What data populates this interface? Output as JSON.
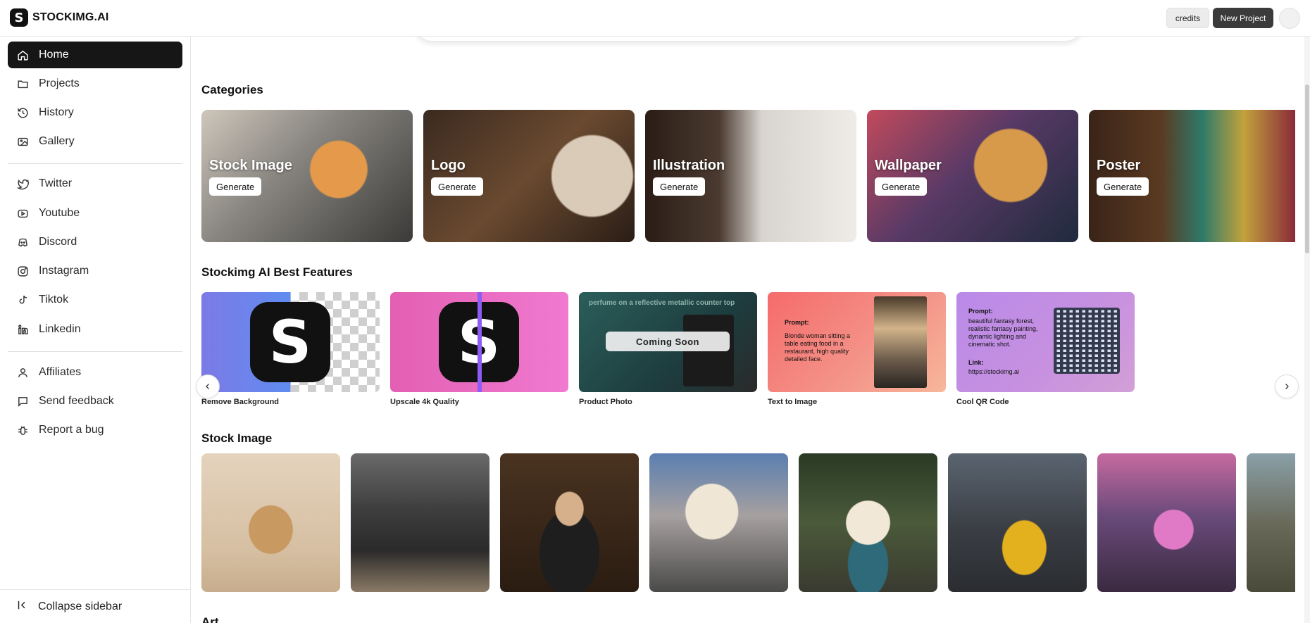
{
  "app": {
    "logo_letter": "S",
    "logo_text": "STOCKIMG.AI"
  },
  "topbar": {
    "credits_label": "credits",
    "new_project_label": "New Project"
  },
  "sidebar": {
    "items": [
      {
        "label": "Home",
        "icon": "home-icon",
        "active": true
      },
      {
        "label": "Projects",
        "icon": "folder-icon"
      },
      {
        "label": "History",
        "icon": "history-icon"
      },
      {
        "label": "Gallery",
        "icon": "gallery-icon"
      },
      {
        "label": "Twitter",
        "icon": "twitter-icon"
      },
      {
        "label": "Youtube",
        "icon": "youtube-icon"
      },
      {
        "label": "Discord",
        "icon": "discord-icon"
      },
      {
        "label": "Instagram",
        "icon": "instagram-icon"
      },
      {
        "label": "Tiktok",
        "icon": "tiktok-icon"
      },
      {
        "label": "Linkedin",
        "icon": "linkedin-icon"
      },
      {
        "label": "Affiliates",
        "icon": "user-icon"
      },
      {
        "label": "Send feedback",
        "icon": "message-icon"
      },
      {
        "label": "Report a bug",
        "icon": "bug-icon"
      }
    ],
    "collapse_label": "Collapse sidebar"
  },
  "main": {
    "categories_title": "Categories",
    "categories": [
      {
        "label": "Stock Image",
        "button": "Generate"
      },
      {
        "label": "Logo",
        "button": "Generate"
      },
      {
        "label": "Illustration",
        "button": "Generate"
      },
      {
        "label": "Wallpaper",
        "button": "Generate"
      },
      {
        "label": "Poster",
        "button": "Generate"
      }
    ],
    "features_title": "Stockimg AI Best Features",
    "features": [
      {
        "caption": "Remove Background"
      },
      {
        "caption": "Upscale 4k Quality"
      },
      {
        "caption": "Product Photo",
        "overlay_prompt": "perfume on a reflective metallic counter top",
        "badge": "Coming Soon"
      },
      {
        "caption": "Text to Image",
        "prompt_label": "Prompt:",
        "prompt_text": "Blonde woman sitting a table eating food in a restaurant, high quality detailed face."
      },
      {
        "caption": "Cool QR Code",
        "prompt_label": "Prompt:",
        "prompt_text": "beautiful fantasy forest, realistic fantasy painting, dynamic lighting and cinematic shot.",
        "link_label": "Link:",
        "link_text": "https://stockimg.ai"
      }
    ],
    "stock_title": "Stock Image",
    "next_title": "Art"
  },
  "colors": {
    "accent_dark": "#161616",
    "new_project_bg": "#3b3b3b",
    "credits_bg": "#ececec"
  }
}
